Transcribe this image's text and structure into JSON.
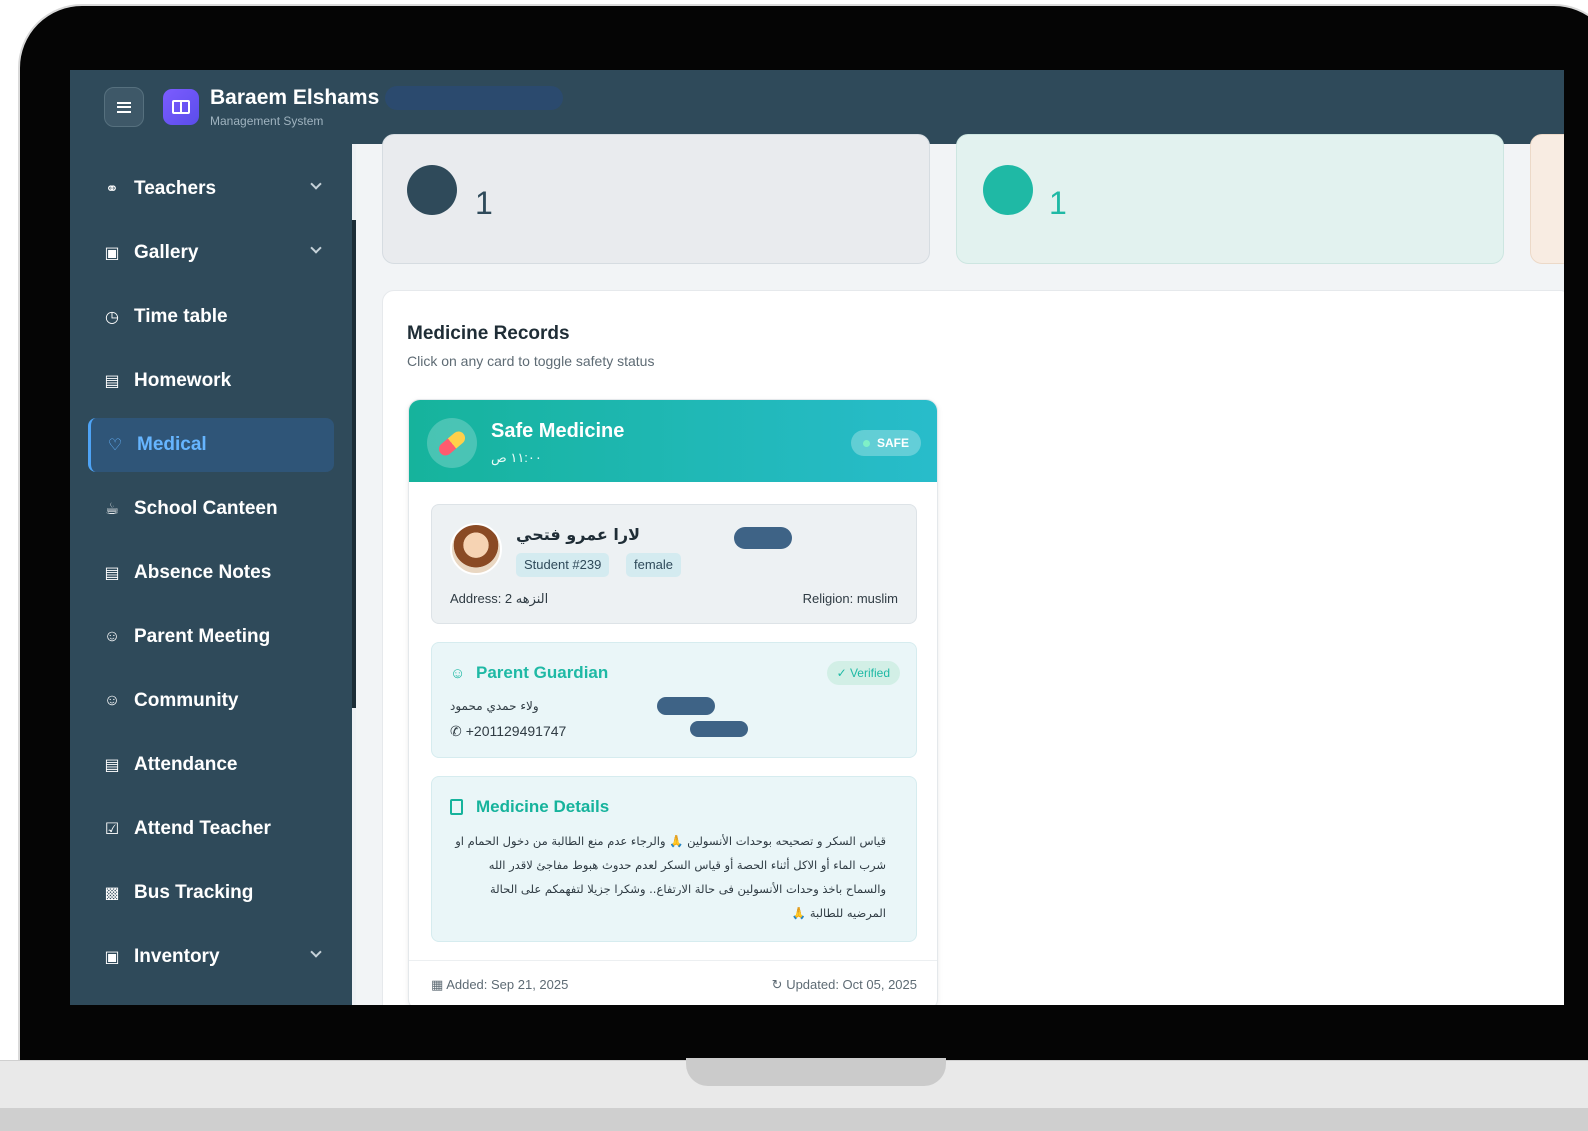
{
  "app": {
    "title": "Baraem Elshams",
    "subtitle": "Management System"
  },
  "sidebar": {
    "items": [
      {
        "label": "Teachers",
        "icon": "user-icon"
      },
      {
        "label": "Gallery",
        "icon": "image-icon"
      },
      {
        "label": "Time table",
        "icon": "clock-icon"
      },
      {
        "label": "Homework",
        "icon": "clipboard-icon"
      },
      {
        "label": "Medical",
        "icon": "heart-icon",
        "active": true
      },
      {
        "label": "School Canteen",
        "icon": "cup-icon"
      },
      {
        "label": "Absence Notes",
        "icon": "document-icon"
      },
      {
        "label": "Parent Meeting",
        "icon": "group-icon"
      },
      {
        "label": "Community",
        "icon": "group-icon"
      },
      {
        "label": "Attendance",
        "icon": "clipboard-icon"
      },
      {
        "label": "Attend Teacher",
        "icon": "clipboard-check-icon"
      },
      {
        "label": "Bus Tracking",
        "icon": "bus-icon"
      },
      {
        "label": "Inventory",
        "icon": "box-icon"
      }
    ]
  },
  "stats": {
    "card_a_value": "1",
    "card_b_value": "1"
  },
  "records": {
    "title": "Medicine Records",
    "subtitle": "Click on any card to toggle safety status",
    "card": {
      "name": "Safe Medicine",
      "time": "١١:٠٠ ص",
      "status": "SAFE",
      "student": {
        "name": "لارا عمرو فتحي",
        "id_tag": "Student #239",
        "gender_tag": "female",
        "address": "Address: 2 النزهه",
        "religion": "Religion: muslim"
      },
      "guardian": {
        "title": "Parent Guardian",
        "verified": "Verified",
        "name": "ولاء حمدي محمود",
        "phone": "+201129491747"
      },
      "details": {
        "title": "Medicine Details",
        "text": "قياس السكر و تصحيحه بوحدات الأنسولين 🙏 والرجاء عدم منع الطالبة من دخول الحمام او شرب الماء أو الاكل أثناء الحصة أو قياس السكر لعدم حدوث هبوط مفاجئ لاقدر الله والسماح باخذ وحدات الأنسولين فى حالة الارتفاع.. وشكرا جزيلا لتفهمكم على الحالة المرضيه للطالبة 🙏"
      },
      "added": "Added: Sep 21, 2025",
      "updated": "Updated: Oct 05, 2025"
    }
  },
  "colors": {
    "sidebar": "#2f4a5a",
    "accent": "#16b39c",
    "active": "#66b5ff"
  }
}
